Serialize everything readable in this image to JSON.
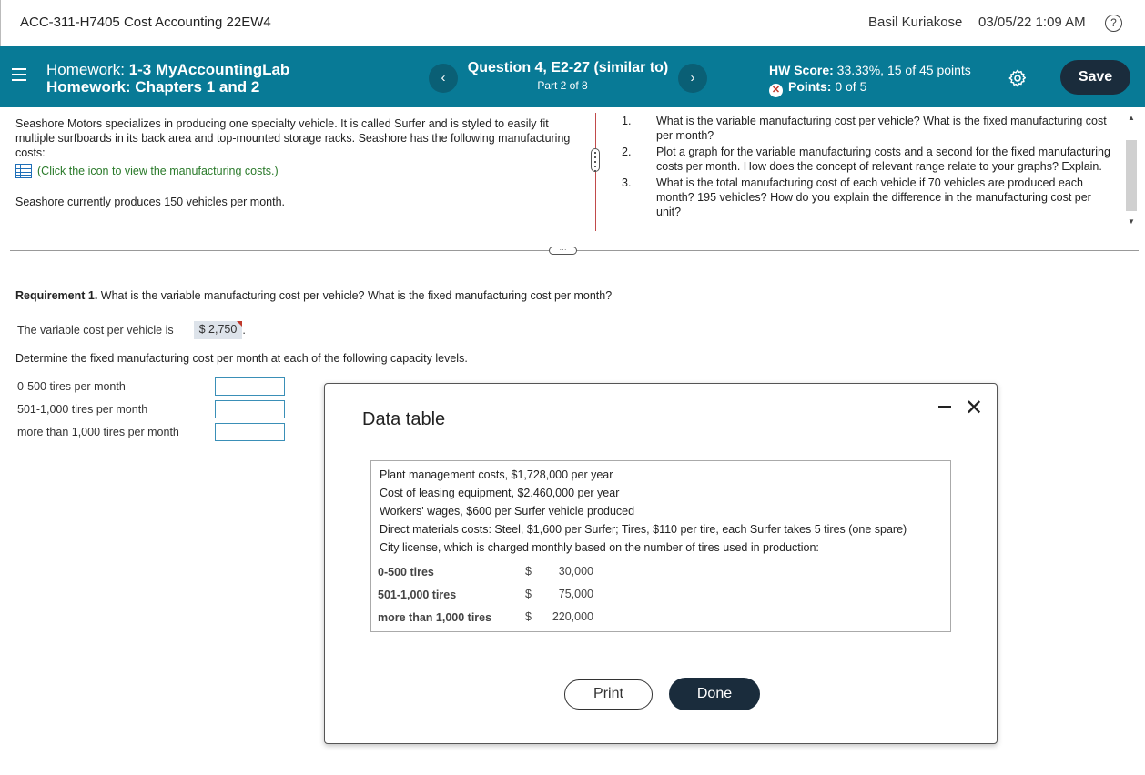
{
  "topbar": {
    "course_title": "ACC-311-H7405 Cost Accounting 22EW4",
    "user_name": "Basil Kuriakose",
    "datetime": "03/05/22 1:09 AM",
    "help_icon": "?"
  },
  "header": {
    "hw1_prefix": "Homework: ",
    "hw1_name": "1-3 MyAccountingLab",
    "hw2_text": "Homework: Chapters 1 and 2",
    "prev_symbol": "‹",
    "next_symbol": "›",
    "question_title": "Question 4, E2-27 (similar to)",
    "question_part": "Part 2 of 8",
    "hw_score_label": "HW Score:",
    "hw_score_value": " 33.33%, 15 of 45 points",
    "points_label": "Points:",
    "points_value": " 0 of 5",
    "save_label": "Save"
  },
  "problem": {
    "description": "Seashore Motors specializes in producing one specialty vehicle. It is called Surfer and is styled to easily fit multiple surfboards in its back area and top-mounted storage racks. Seashore has the following manufacturing costs:",
    "icon_link": "(Click the icon to view the manufacturing costs.)",
    "currently": "Seashore currently produces 150 vehicles per month.",
    "requirements": [
      {
        "num": "1.",
        "text": "What is the variable manufacturing cost per vehicle? What is the fixed manufacturing cost per month?"
      },
      {
        "num": "2.",
        "text": "Plot a graph for the variable manufacturing costs and a second for the fixed manufacturing costs per month. How does the concept of relevant range relate to your graphs? Explain."
      },
      {
        "num": "3.",
        "text": "What is the total manufacturing cost of each vehicle if 70 vehicles are produced each month? 195 vehicles? How do you explain the difference in the manufacturing cost per unit?"
      }
    ]
  },
  "answer": {
    "requirement_label": "Requirement 1.",
    "requirement_text": " What is the variable manufacturing cost per vehicle? What is the fixed manufacturing cost per month?",
    "variable_label": "The variable cost per vehicle is",
    "variable_value": "$   2,750",
    "variable_suffix": ".",
    "determine_text": "Determine the fixed manufacturing cost per month at each of the following capacity levels.",
    "capacity_levels": [
      {
        "label": "0-500 tires per month",
        "value": ""
      },
      {
        "label": "501-1,000 tires per month",
        "value": ""
      },
      {
        "label": "more than 1,000 tires per month",
        "value": ""
      }
    ]
  },
  "modal": {
    "title": "Data table",
    "lines": [
      "Plant management costs, $1,728,000 per year",
      "Cost of leasing equipment, $2,460,000 per year",
      "Workers' wages, $600 per Surfer vehicle produced",
      "Direct materials costs: Steel, $1,600 per Surfer; Tires, $110 per tire, each Surfer takes 5 tires (one spare)",
      "City license, which is charged monthly based on the number of tires used in production:"
    ],
    "license_fees": [
      {
        "label": "0-500 tires",
        "dollar": "$",
        "amount": "30,000"
      },
      {
        "label": "501-1,000 tires",
        "dollar": "$",
        "amount": "75,000"
      },
      {
        "label": "more than 1,000 tires",
        "dollar": "$",
        "amount": "220,000"
      }
    ],
    "print_label": "Print",
    "done_label": "Done",
    "close_symbol": "✕"
  }
}
